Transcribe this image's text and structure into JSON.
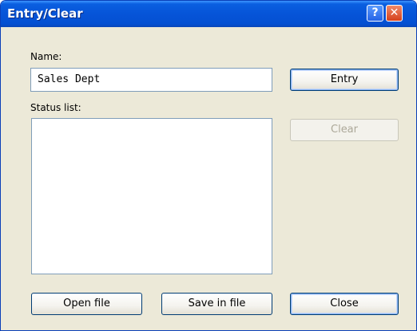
{
  "window": {
    "title": "Entry/Clear",
    "help_glyph": "?",
    "close_glyph": "✕"
  },
  "name_label": "Name:",
  "name_value": "Sales Dept",
  "status_label": "Status list:",
  "status_items": [],
  "buttons": {
    "entry": "Entry",
    "clear": "Clear",
    "open_file": "Open file",
    "save_in_file": "Save in file",
    "close": "Close"
  },
  "colors": {
    "titlebar": "#0654d8",
    "dialog_bg": "#ece9d8",
    "field_border": "#7f9db9",
    "button_border": "#003c74"
  }
}
